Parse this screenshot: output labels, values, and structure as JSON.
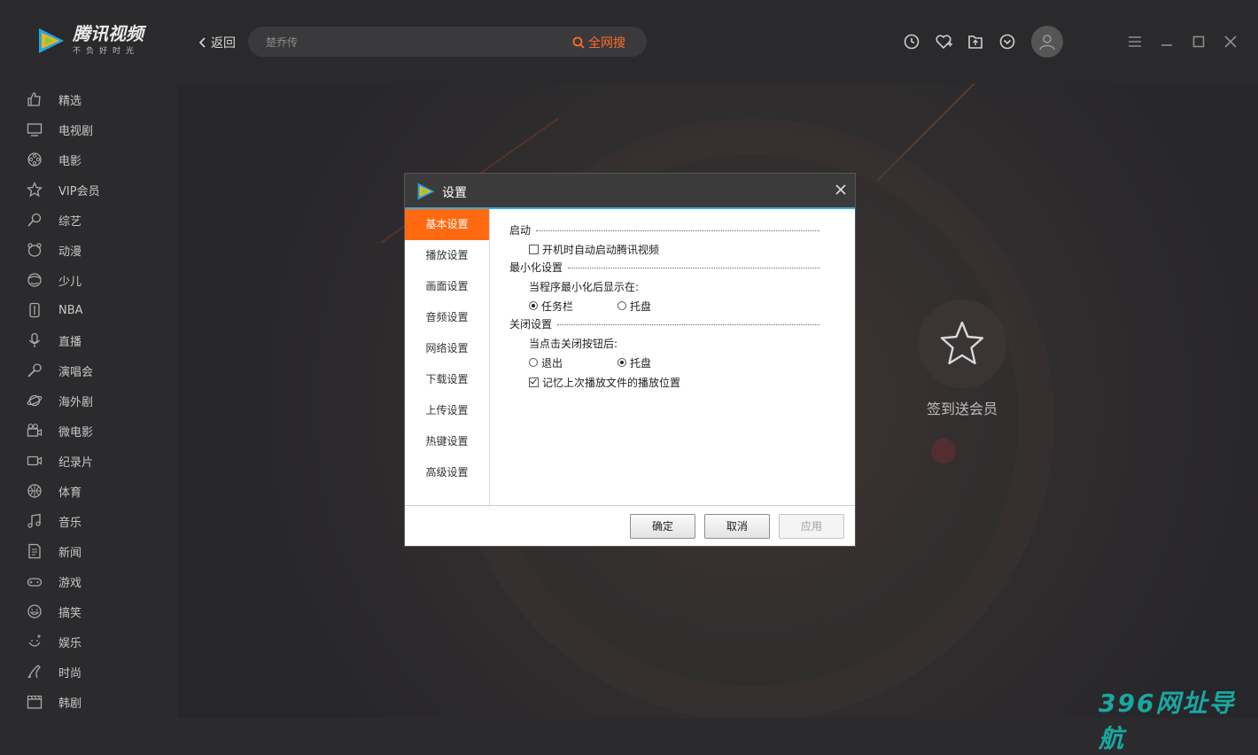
{
  "app": {
    "brand": "腾讯视频",
    "slogan": "不负好时光"
  },
  "header": {
    "back_label": "返回",
    "search_placeholder": "楚乔传",
    "search_button": "全网搜",
    "accent": "#ff6a2a"
  },
  "sidebar": {
    "items": [
      {
        "label": "精选",
        "icon": "thumbs-up-icon"
      },
      {
        "label": "电视剧",
        "icon": "tv-icon"
      },
      {
        "label": "电影",
        "icon": "film-reel-icon"
      },
      {
        "label": "VIP会员",
        "icon": "star-icon"
      },
      {
        "label": "综艺",
        "icon": "mic-person-icon"
      },
      {
        "label": "动漫",
        "icon": "bear-icon"
      },
      {
        "label": "少儿",
        "icon": "kid-face-icon"
      },
      {
        "label": "NBA",
        "icon": "nba-icon"
      },
      {
        "label": "直播",
        "icon": "microphone-icon"
      },
      {
        "label": "演唱会",
        "icon": "concert-mic-icon"
      },
      {
        "label": "海外剧",
        "icon": "planet-icon"
      },
      {
        "label": "微电影",
        "icon": "camera-icon"
      },
      {
        "label": "纪录片",
        "icon": "video-camera-icon"
      },
      {
        "label": "体育",
        "icon": "basketball-icon"
      },
      {
        "label": "音乐",
        "icon": "music-note-icon"
      },
      {
        "label": "新闻",
        "icon": "news-icon"
      },
      {
        "label": "游戏",
        "icon": "gamepad-icon"
      },
      {
        "label": "搞笑",
        "icon": "laugh-face-icon"
      },
      {
        "label": "娱乐",
        "icon": "sparkle-face-icon"
      },
      {
        "label": "时尚",
        "icon": "high-heel-icon"
      },
      {
        "label": "韩剧",
        "icon": "clapperboard-icon"
      }
    ]
  },
  "checkin": {
    "label": "签到送会员"
  },
  "watermark": "396网址导航",
  "dialog": {
    "title": "设置",
    "nav": [
      "基本设置",
      "播放设置",
      "画面设置",
      "音频设置",
      "网络设置",
      "下载设置",
      "上传设置",
      "热键设置",
      "高级设置"
    ],
    "active_nav": "基本设置",
    "sections": {
      "startup": {
        "title": "启动",
        "autostart_label": "开机时自动启动腾讯视频",
        "autostart_checked": false
      },
      "minimize": {
        "title": "最小化设置",
        "prompt": "当程序最小化后显示在:",
        "opt1": "任务栏",
        "opt2": "托盘",
        "selected": "任务栏"
      },
      "close": {
        "title": "关闭设置",
        "prompt": "当点击关闭按钮后:",
        "opt1": "退出",
        "opt2": "托盘",
        "selected": "托盘",
        "remember_label": "记忆上次播放文件的播放位置",
        "remember_checked": true
      }
    },
    "buttons": {
      "ok": "确定",
      "cancel": "取消",
      "apply": "应用"
    }
  }
}
